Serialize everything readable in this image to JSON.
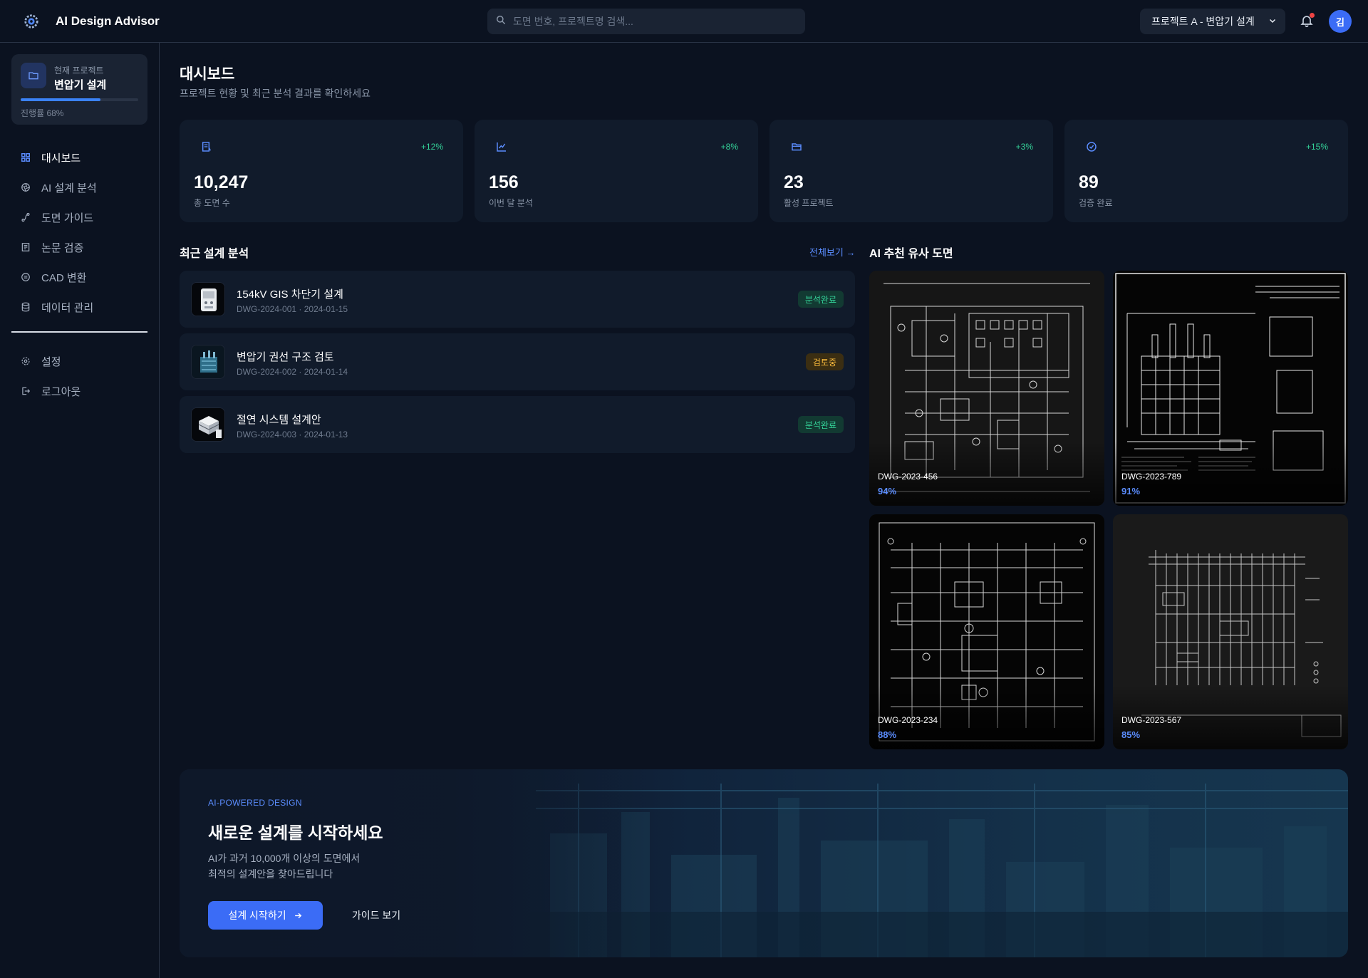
{
  "app": {
    "title": "AI Design Advisor"
  },
  "search": {
    "placeholder": "도면 번호, 프로젝트명 검색..."
  },
  "project_select": {
    "value": "프로젝트 A - 변압기 설계"
  },
  "user": {
    "avatar_initial": "김"
  },
  "sidebar": {
    "current_project": {
      "caption": "현재 프로젝트",
      "name": "변압기 설계",
      "progress_label": "진행률 68%",
      "progress": 0.68
    },
    "items": [
      {
        "label": "대시보드",
        "icon": "grid-icon",
        "active": true
      },
      {
        "label": "AI 설계 분석",
        "icon": "aperture-icon",
        "active": false
      },
      {
        "label": "도면 가이드",
        "icon": "route-icon",
        "active": false
      },
      {
        "label": "논문 검증",
        "icon": "document-icon",
        "active": false
      },
      {
        "label": "CAD 변환",
        "icon": "convert-icon",
        "active": false
      },
      {
        "label": "데이터 관리",
        "icon": "database-icon",
        "active": false
      }
    ],
    "bottom_items": [
      {
        "label": "설정",
        "icon": "gear-icon"
      },
      {
        "label": "로그아웃",
        "icon": "logout-icon"
      }
    ]
  },
  "page": {
    "title": "대시보드",
    "subtitle": "프로젝트 현황 및 최근 분석 결과를 확인하세요"
  },
  "stats": [
    {
      "value": "10,247",
      "label": "총 도면 수",
      "delta": "+12%",
      "icon": "file-icon"
    },
    {
      "value": "156",
      "label": "이번 달 분석",
      "delta": "+8%",
      "icon": "chart-icon"
    },
    {
      "value": "23",
      "label": "활성 프로젝트",
      "delta": "+3%",
      "icon": "folder-icon"
    },
    {
      "value": "89",
      "label": "검증 완료",
      "delta": "+15%",
      "icon": "check-circle-icon"
    }
  ],
  "recent": {
    "title": "최근 설계 분석",
    "view_all": "전체보기 →",
    "items": [
      {
        "title": "154kV GIS 차단기 설계",
        "code": "DWG-2024-001",
        "date": "2024-01-15",
        "status": "분석완료",
        "status_color": "#34d399"
      },
      {
        "title": "변압기 권선 구조 검토",
        "code": "DWG-2024-002",
        "date": "2024-01-14",
        "status": "검토중",
        "status_color": "#f5b73a"
      },
      {
        "title": "절연 시스템 설계안",
        "code": "DWG-2024-003",
        "date": "2024-01-13",
        "status": "분석완료",
        "status_color": "#34d399"
      }
    ]
  },
  "recommend": {
    "title": "AI 추천 유사 도면",
    "items": [
      {
        "code": "DWG-2023-456",
        "score": "94%"
      },
      {
        "code": "DWG-2023-789",
        "score": "91%"
      },
      {
        "code": "DWG-2023-234",
        "score": "88%"
      },
      {
        "code": "DWG-2023-567",
        "score": "85%"
      }
    ]
  },
  "hero": {
    "eyebrow": "AI-POWERED DESIGN",
    "title": "새로운 설계를 시작하세요",
    "desc_line1": "AI가 과거 10,000개 이상의 도면에서",
    "desc_line2": "최적의 설계안을 찾아드립니다",
    "primary_button": "설계 시작하기",
    "secondary_button": "가이드 보기"
  },
  "colors": {
    "accent": "#3b6cf6",
    "link": "#5b8dff",
    "success": "#34d399",
    "warning": "#f5b73a",
    "background": "#0b1220",
    "card": "#111b2b"
  }
}
